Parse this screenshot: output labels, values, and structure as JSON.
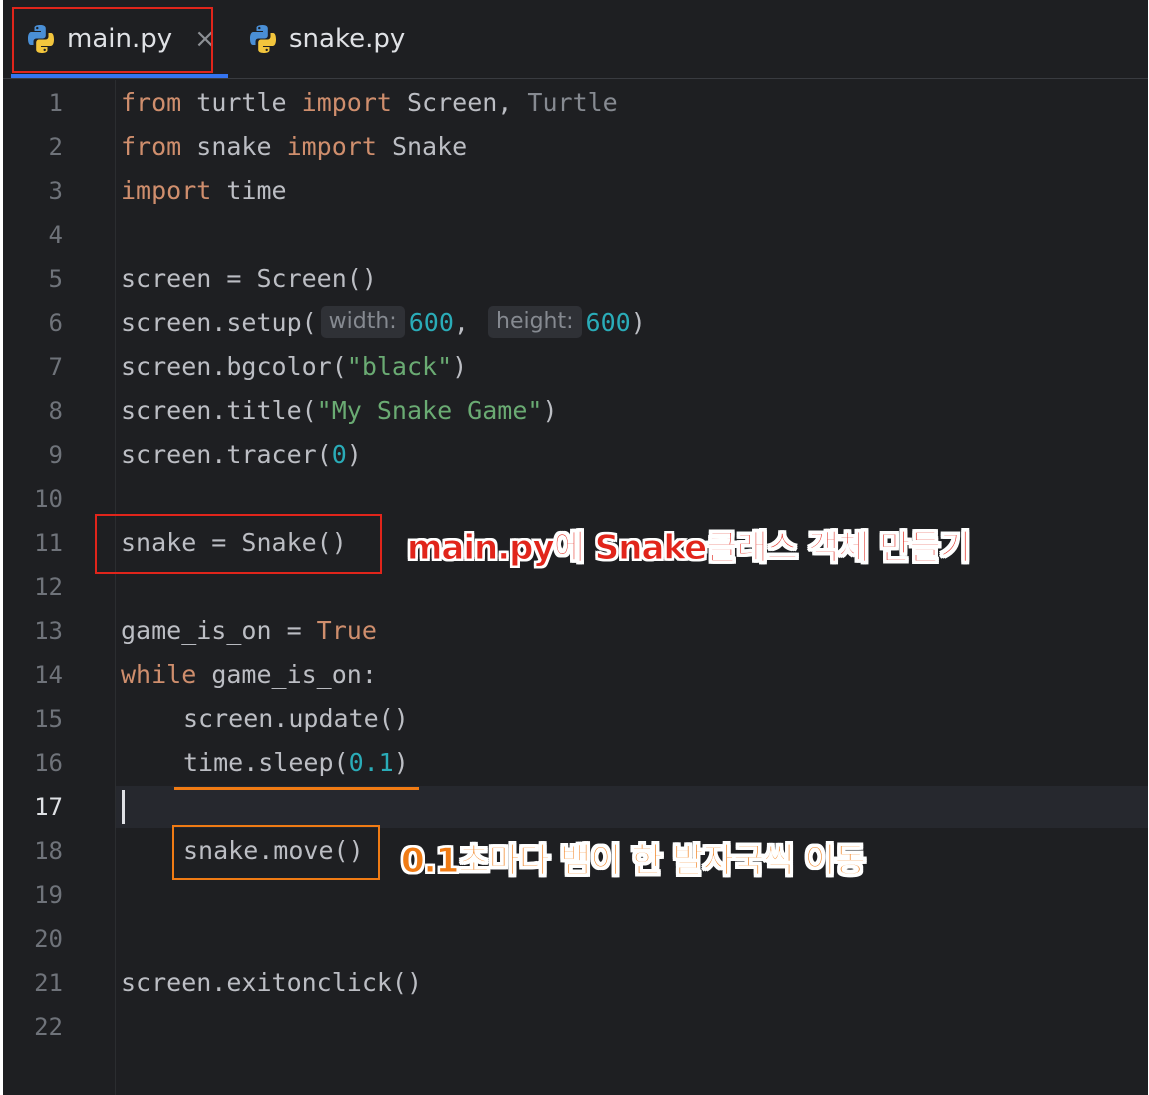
{
  "tabs": [
    {
      "label": "main.py",
      "icon": "python-icon",
      "active": true,
      "close_glyph": "×"
    },
    {
      "label": "snake.py",
      "icon": "python-icon",
      "active": false
    }
  ],
  "gutter": {
    "line_numbers": [
      "1",
      "2",
      "3",
      "4",
      "5",
      "6",
      "7",
      "8",
      "9",
      "10",
      "11",
      "12",
      "13",
      "14",
      "15",
      "16",
      "17",
      "18",
      "19",
      "20",
      "21",
      "22"
    ],
    "current_line": "17"
  },
  "code": {
    "l1": {
      "k1": "from",
      "t1": " turtle ",
      "k2": "import",
      "t2": " Screen, ",
      "d1": "Turtle"
    },
    "l2": {
      "k1": "from",
      "t1": " snake ",
      "k2": "import",
      "t2": " Snake"
    },
    "l3": {
      "k1": "import",
      "t1": " time"
    },
    "l5": {
      "t1": "screen = Screen()"
    },
    "l6": {
      "t1": "screen.setup(",
      "h1": "width:",
      "n1": "600",
      "t2": ", ",
      "h2": "height:",
      "n2": "600",
      "t3": ")"
    },
    "l7": {
      "t1": "screen.bgcolor(",
      "s1": "\"black\"",
      "t2": ")"
    },
    "l8": {
      "t1": "screen.title(",
      "s1": "\"My Snake Game\"",
      "t2": ")"
    },
    "l9": {
      "t1": "screen.tracer(",
      "n1": "0",
      "t2": ")"
    },
    "l11": {
      "t1": "snake = Snake()"
    },
    "l13": {
      "t1": "game_is_on = ",
      "k1": "True"
    },
    "l14": {
      "k1": "while",
      "t1": " game_is_on:"
    },
    "l15": {
      "t1": "screen.update()"
    },
    "l16": {
      "t1": "time.sleep(",
      "n1": "0.1",
      "t2": ")"
    },
    "l18": {
      "t1": "snake.move()"
    },
    "l21": {
      "t1": "screen.exitonclick()"
    }
  },
  "annotations": {
    "snake_note": "main.py에 Snake클래스 객체 만들기",
    "move_note": "0.1초마다 뱀이 한 발자국씩 이동"
  },
  "colors": {
    "background": "#1e1f22",
    "keyword": "#cf8e6d",
    "string": "#6aab73",
    "number": "#2aacb8",
    "text": "#bcbec4",
    "annotation_red": "#e1251b",
    "annotation_orange": "#f07b14",
    "tab_underline": "#3574f0"
  }
}
